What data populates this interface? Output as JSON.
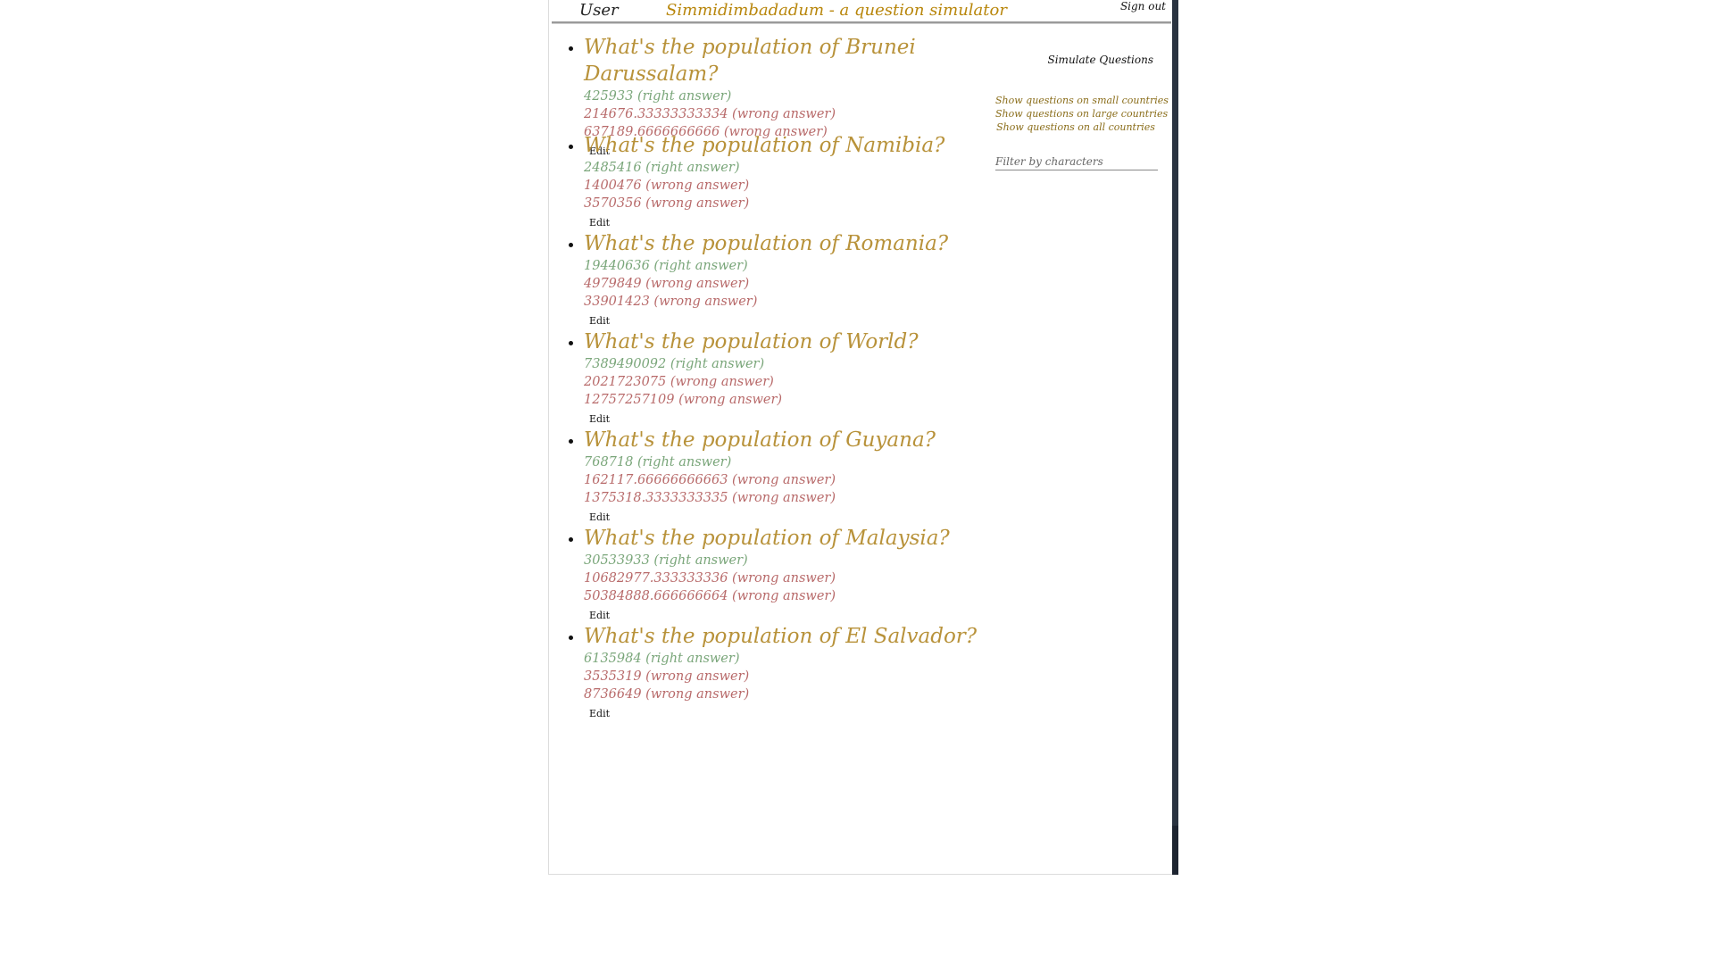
{
  "header": {
    "user": "User",
    "title": "Simmidimbadadum - a question simulator",
    "signout": "Sign out"
  },
  "sidebar": {
    "simulate": "Simulate Questions",
    "filters": [
      "Show questions on small countries",
      "Show questions on large countries",
      "Show questions on all countries"
    ],
    "filter_placeholder": "Filter by characters"
  },
  "edit_label": "Edit",
  "questions": [
    {
      "title": "What's the population of Brunei Darussalam?",
      "answers": [
        {
          "text": "425933 (right answer)",
          "kind": "right"
        },
        {
          "text": "214676.33333333334 (wrong answer)",
          "kind": "wrong"
        },
        {
          "text": "637189.6666666666 (wrong answer)",
          "kind": "wrong"
        }
      ]
    },
    {
      "title": "What's the population of Namibia?",
      "answers": [
        {
          "text": "2485416 (right answer)",
          "kind": "right"
        },
        {
          "text": "1400476 (wrong answer)",
          "kind": "wrong"
        },
        {
          "text": "3570356 (wrong answer)",
          "kind": "wrong"
        }
      ]
    },
    {
      "title": "What's the population of Romania?",
      "answers": [
        {
          "text": "19440636 (right answer)",
          "kind": "right"
        },
        {
          "text": "4979849 (wrong answer)",
          "kind": "wrong"
        },
        {
          "text": "33901423 (wrong answer)",
          "kind": "wrong"
        }
      ]
    },
    {
      "title": "What's the population of World?",
      "answers": [
        {
          "text": "7389490092 (right answer)",
          "kind": "right"
        },
        {
          "text": "2021723075 (wrong answer)",
          "kind": "wrong"
        },
        {
          "text": "12757257109 (wrong answer)",
          "kind": "wrong"
        }
      ]
    },
    {
      "title": "What's the population of Guyana?",
      "answers": [
        {
          "text": "768718 (right answer)",
          "kind": "right"
        },
        {
          "text": "162117.66666666663 (wrong answer)",
          "kind": "wrong"
        },
        {
          "text": "1375318.3333333335 (wrong answer)",
          "kind": "wrong"
        }
      ]
    },
    {
      "title": "What's the population of Malaysia?",
      "answers": [
        {
          "text": "30533933 (right answer)",
          "kind": "right"
        },
        {
          "text": "10682977.333333336 (wrong answer)",
          "kind": "wrong"
        },
        {
          "text": "50384888.666666664 (wrong answer)",
          "kind": "wrong"
        }
      ]
    },
    {
      "title": "What's the population of El Salvador?",
      "answers": [
        {
          "text": "6135984 (right answer)",
          "kind": "right"
        },
        {
          "text": "3535319 (wrong answer)",
          "kind": "wrong"
        },
        {
          "text": "8736649 (wrong answer)",
          "kind": "wrong"
        }
      ]
    }
  ]
}
